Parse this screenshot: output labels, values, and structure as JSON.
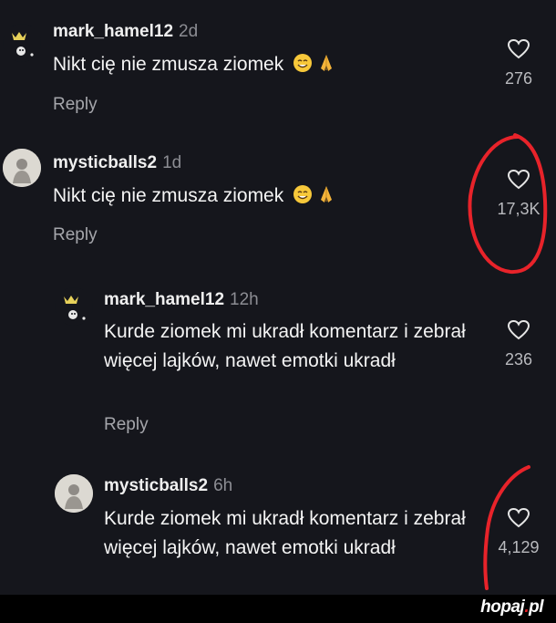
{
  "comments": [
    {
      "username": "mark_hamel12",
      "time": "2d",
      "text": "Nikt cię nie zmusza ziomek",
      "reply_label": "Reply",
      "likes": "276"
    },
    {
      "username": "mysticballs2",
      "time": "1d",
      "text": "Nikt cię nie zmusza ziomek",
      "reply_label": "Reply",
      "likes": "17,3K"
    },
    {
      "username": "mark_hamel12",
      "time": "12h",
      "text": "Kurde ziomek mi ukradł komentarz i zebrał więcej lajków, nawet emotki ukradł",
      "reply_label": "Reply",
      "likes": "236"
    },
    {
      "username": "mysticballs2",
      "time": "6h",
      "text": "Kurde ziomek mi ukradł komentarz i zebrał więcej lajków, nawet emotki ukradł",
      "likes": "4,129"
    }
  ],
  "watermark": {
    "name": "hopaj",
    "dot": ".",
    "tld": "pl"
  },
  "colors": {
    "background": "#15161c",
    "annotation": "#e8232a",
    "watermark_accent": "#e21d23"
  },
  "icons": {
    "like": "heart-outline-icon",
    "emoji_face": "smiling-face-emoji",
    "emoji_hands": "folded-hands-emoji"
  }
}
